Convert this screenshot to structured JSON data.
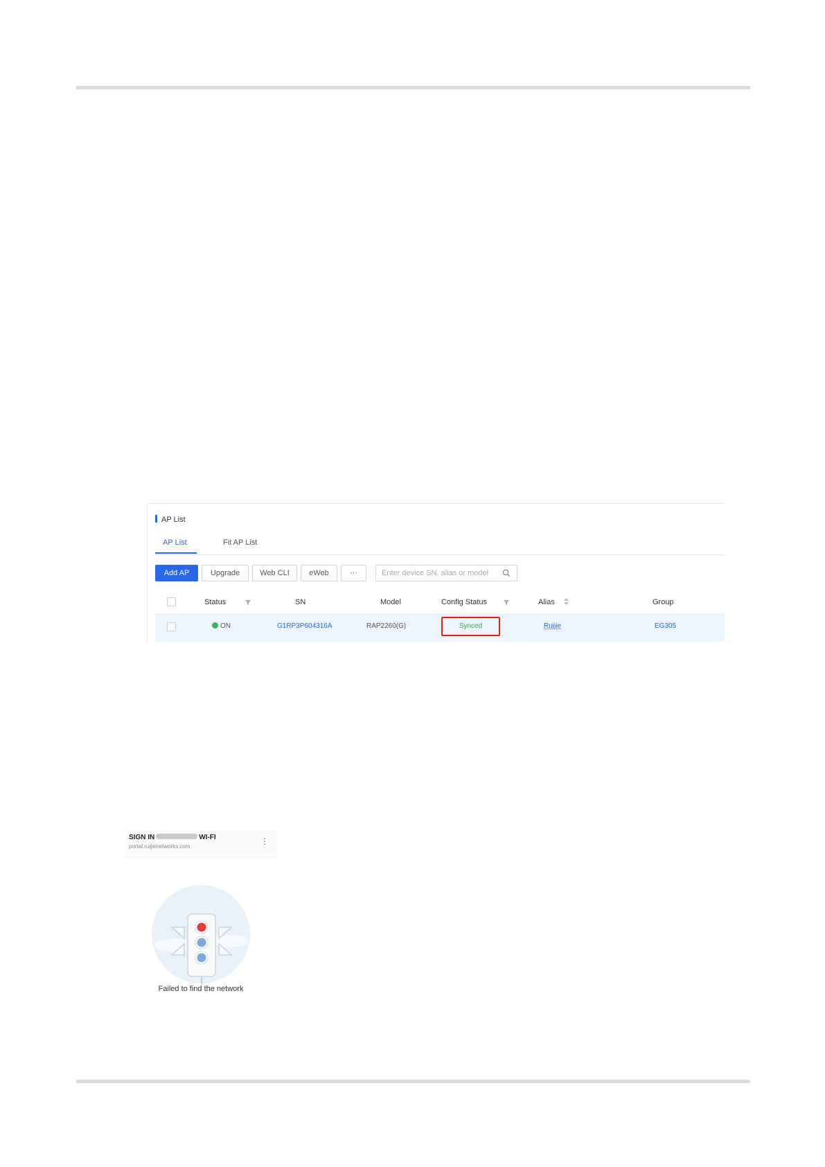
{
  "ap_list": {
    "title": "AP List",
    "tabs": [
      {
        "label": "AP List",
        "active": true
      },
      {
        "label": "Fit AP List",
        "active": false
      }
    ],
    "toolbar": {
      "add_ap": "Add AP",
      "upgrade": "Upgrade",
      "web_cli": "Web CLI",
      "eweb": "eWeb",
      "more": "···",
      "search_placeholder": "Enter device SN, alias or model"
    },
    "columns": {
      "status": "Status",
      "sn": "SN",
      "model": "Model",
      "config_status": "Config Status",
      "alias": "Alias",
      "group": "Group"
    },
    "rows": [
      {
        "status": "ON",
        "sn": "G1RP3P604316A",
        "model": "RAP2260(G)",
        "config_status": "Synced",
        "alias": "Ruijie",
        "group": "EG305"
      }
    ],
    "colors": {
      "accent": "#2a66e8",
      "online": "#3bb15a",
      "synced": "#3aa845",
      "highlight": "#e0241b"
    }
  },
  "phone": {
    "signin_prefix": "SIGN IN",
    "signin_suffix": "WI-FI",
    "portal_url": "portal.ruijienetworks.com",
    "menu_icon": "kebab-icon",
    "message": "Failed to find the network"
  }
}
